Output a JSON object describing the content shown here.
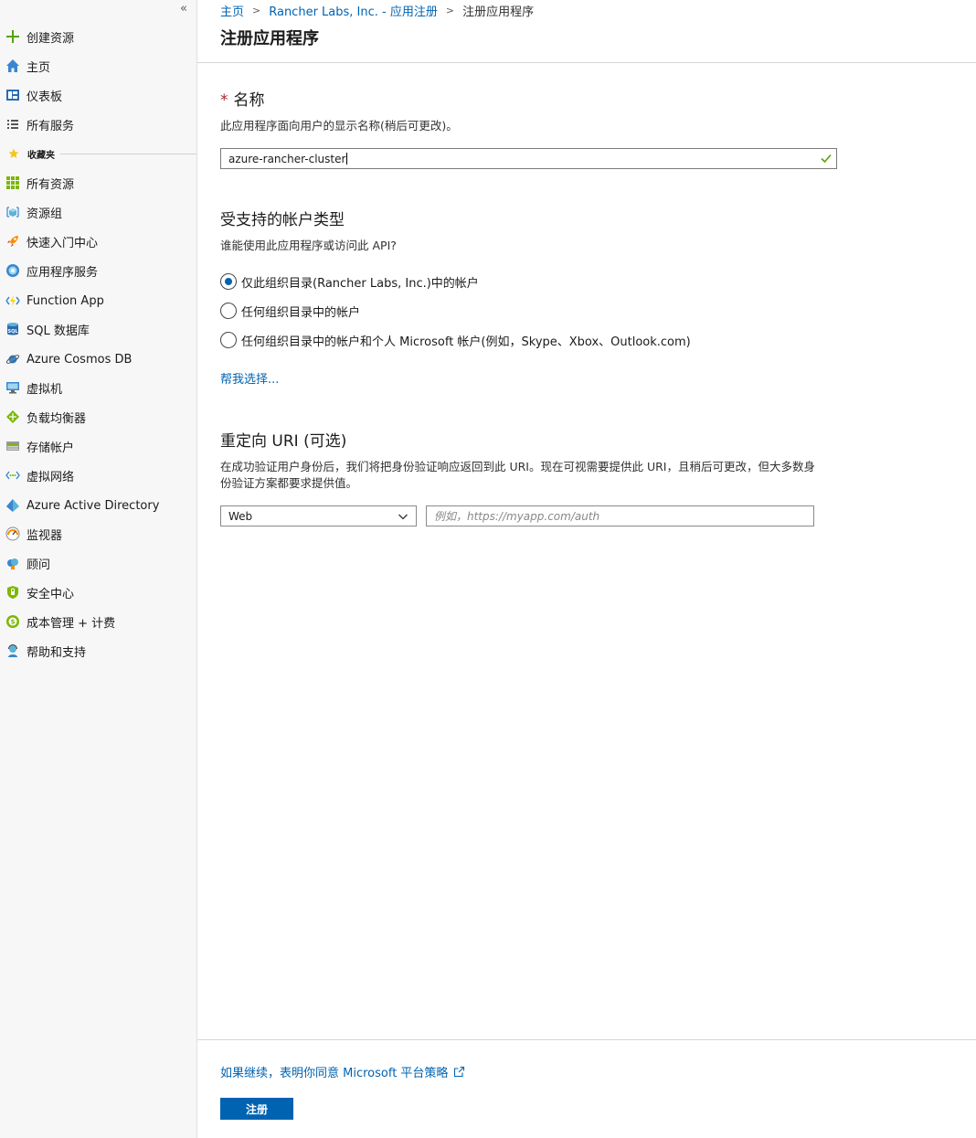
{
  "sidebar": {
    "collapse_glyph": "«",
    "items_top": [
      {
        "label": "创建资源",
        "icon": "plus-icon"
      },
      {
        "label": "主页",
        "icon": "home-icon"
      },
      {
        "label": "仪表板",
        "icon": "dashboard-icon"
      },
      {
        "label": "所有服务",
        "icon": "list-icon"
      }
    ],
    "favorites_label": "收藏夹",
    "items_fav": [
      {
        "label": "所有资源",
        "icon": "grid-icon"
      },
      {
        "label": "资源组",
        "icon": "cube-icon"
      },
      {
        "label": "快速入门中心",
        "icon": "rocket-icon"
      },
      {
        "label": "应用程序服务",
        "icon": "globe-icon"
      },
      {
        "label": "Function App",
        "icon": "lightning-icon"
      },
      {
        "label": "SQL 数据库",
        "icon": "sql-icon"
      },
      {
        "label": "Azure Cosmos DB",
        "icon": "planet-icon"
      },
      {
        "label": "虚拟机",
        "icon": "monitor-icon"
      },
      {
        "label": "负载均衡器",
        "icon": "diamond-icon"
      },
      {
        "label": "存储帐户",
        "icon": "storage-icon"
      },
      {
        "label": "虚拟网络",
        "icon": "network-icon"
      },
      {
        "label": "Azure Active Directory",
        "icon": "aad-icon"
      },
      {
        "label": "监视器",
        "icon": "gauge-icon"
      },
      {
        "label": "顾问",
        "icon": "cloud-icon"
      },
      {
        "label": "安全中心",
        "icon": "shield-icon"
      },
      {
        "label": "成本管理 + 计费",
        "icon": "cost-icon"
      },
      {
        "label": "帮助和支持",
        "icon": "support-icon"
      }
    ]
  },
  "breadcrumb": {
    "home": "主页",
    "parent": "Rancher Labs, Inc. - 应用注册",
    "current": "注册应用程序"
  },
  "page_title": "注册应用程序",
  "name_section": {
    "required_mark": "*",
    "title": "名称",
    "description": "此应用程序面向用户的显示名称(稍后可更改)。",
    "value": "azure-rancher-cluster"
  },
  "account_section": {
    "title": "受支持的帐户类型",
    "question": "谁能使用此应用程序或访问此 API?",
    "options": [
      {
        "label": "仅此组织目录(Rancher Labs, Inc.)中的帐户",
        "selected": true
      },
      {
        "label": "任何组织目录中的帐户",
        "selected": false
      },
      {
        "label": "任何组织目录中的帐户和个人 Microsoft 帐户(例如，Skype、Xbox、Outlook.com)",
        "selected": false
      }
    ],
    "help_link": "帮我选择..."
  },
  "redirect_section": {
    "title": "重定向 URI (可选)",
    "description_line1": "在成功验证用户身份后，我们将把身份验证响应返回到此 URI。现在可视需要提供此 URI，且稍后可更改，但大多数身",
    "description_line2": "份验证方案都要求提供值。",
    "platform_selected": "Web",
    "uri_placeholder": "例如，https://myapp.com/auth"
  },
  "footer": {
    "policy_text": "如果继续，表明你同意 Microsoft 平台策略",
    "register_label": "注册"
  },
  "colors": {
    "accent": "#0063b1",
    "required": "#a4262c",
    "valid": "#57a300"
  }
}
